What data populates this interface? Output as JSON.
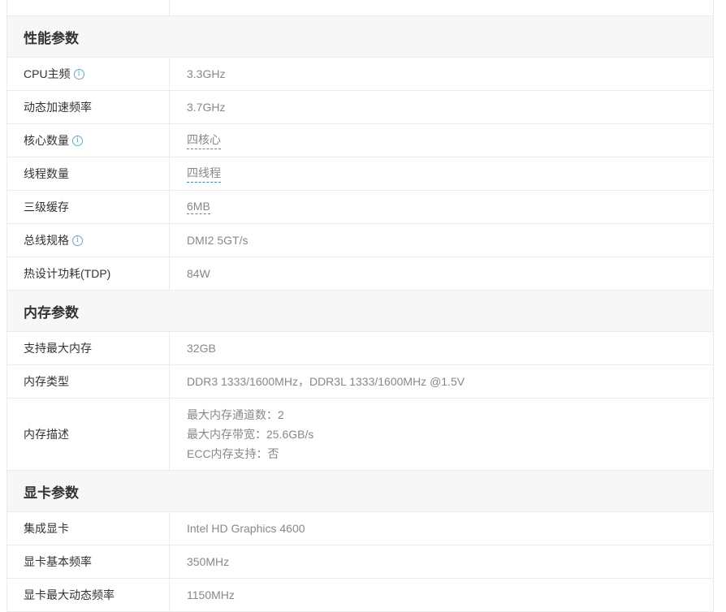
{
  "sections": {
    "performance": {
      "title": "性能参数",
      "rows": [
        {
          "key": "CPU主频",
          "value": "3.3GHz"
        },
        {
          "key": "动态加速频率",
          "value": "3.7GHz"
        },
        {
          "key": "核心数量",
          "value": "四核心"
        },
        {
          "key": "线程数量",
          "value": "四线程"
        },
        {
          "key": "三级缓存",
          "value": "6MB"
        },
        {
          "key": "总线规格",
          "value": "DMI2 5GT/s"
        },
        {
          "key": "热设计功耗(TDP)",
          "value": "84W"
        }
      ]
    },
    "memory": {
      "title": "内存参数",
      "rows": [
        {
          "key": "支持最大内存",
          "value": "32GB"
        },
        {
          "key": "内存类型",
          "value": "DDR3 1333/1600MHz，DDR3L 1333/1600MHz @1.5V"
        },
        {
          "key": "内存描述",
          "lines": [
            "最大内存通道数：2",
            "最大内存带宽：25.6GB/s",
            "ECC内存支持：否"
          ]
        }
      ]
    },
    "graphics": {
      "title": "显卡参数",
      "rows": [
        {
          "key": "集成显卡",
          "value": "Intel HD Graphics 4600"
        },
        {
          "key": "显卡基本频率",
          "value": "350MHz"
        },
        {
          "key": "显卡最大动态频率",
          "value": "1150MHz"
        }
      ]
    }
  },
  "icons": {
    "info": "info-circle-icon",
    "info_glyph": "i"
  },
  "colors": {
    "section_bg": "#f7f7f7",
    "border": "#ececec",
    "info_blue": "#5aa9e6",
    "link_dash": "#3d8bd4"
  }
}
